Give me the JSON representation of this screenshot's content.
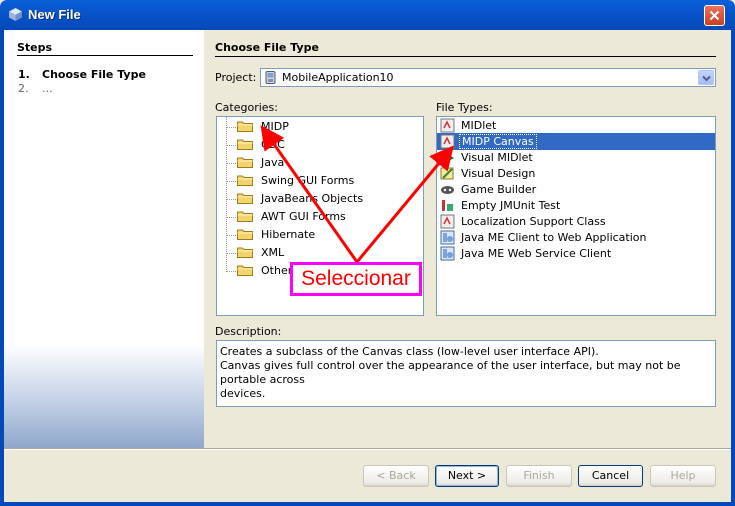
{
  "window": {
    "title": "New File"
  },
  "steps": {
    "heading": "Steps",
    "items": [
      {
        "num": "1.",
        "label": "Choose File Type",
        "active": true
      },
      {
        "num": "2.",
        "label": "...",
        "active": false
      }
    ]
  },
  "main": {
    "heading": "Choose File Type",
    "project_label": "Project:",
    "project_value": "MobileApplication10",
    "categories_label": "Categories:",
    "categories": [
      "MIDP",
      "CDC",
      "Java",
      "Swing GUI Forms",
      "JavaBeans Objects",
      "AWT GUI Forms",
      "Hibernate",
      "XML",
      "Other"
    ],
    "file_types_label": "File Types:",
    "file_types": [
      {
        "label": "MIDlet",
        "icon": "midlet-icon"
      },
      {
        "label": "MIDP Canvas",
        "icon": "midp-canvas-icon",
        "selected": true
      },
      {
        "label": "Visual MIDlet",
        "icon": "visual-midlet-icon"
      },
      {
        "label": "Visual Design",
        "icon": "visual-design-icon"
      },
      {
        "label": "Game Builder",
        "icon": "game-builder-icon"
      },
      {
        "label": "Empty JMUnit Test",
        "icon": "jmunit-icon"
      },
      {
        "label": "Localization Support Class",
        "icon": "localization-icon"
      },
      {
        "label": "Java ME Client to Web Application",
        "icon": "web-client-icon"
      },
      {
        "label": "Java ME Web Service Client",
        "icon": "web-service-icon"
      }
    ],
    "description_label": "Description:",
    "description_lines": [
      "Creates a subclass of the Canvas class (low-level user interface API).",
      "Canvas gives full control over the appearance of the user interface, but may not be portable across",
      "devices."
    ]
  },
  "buttons": {
    "back": "< Back",
    "next": "Next >",
    "finish": "Finish",
    "cancel": "Cancel",
    "help": "Help"
  },
  "annotation": {
    "callout_text": "Seleccionar",
    "callout_color": "#ff00ff",
    "arrow_color": "#ff0000"
  }
}
